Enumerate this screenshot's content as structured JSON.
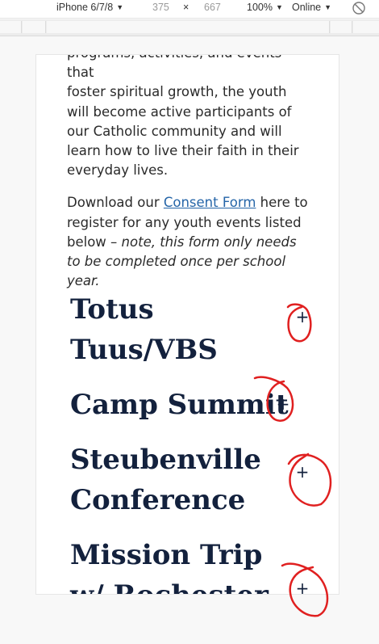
{
  "devtools": {
    "device": "iPhone 6/7/8",
    "width": "375",
    "times": "×",
    "height": "667",
    "zoom": "100%",
    "network": "Online"
  },
  "page": {
    "partial_line": "programs, activities, and events that",
    "paragraph1": "foster spiritual growth, the youth will become active participants of our Catholic community and will learn how to live their faith in their everyday lives.",
    "p2_before": "Download our ",
    "consent_link": "Consent Form",
    "p2_after": " here to register for any youth events listed below – ",
    "p2_note": "note, this form only needs to be completed once per school year."
  },
  "accordion": [
    {
      "title": "Totus Tuus/VBS",
      "toggle": "+"
    },
    {
      "title": "Camp Summit",
      "toggle": "+"
    },
    {
      "title": "Steubenville Conference",
      "toggle": "+"
    },
    {
      "title": "Mission Trip w/ Rochester",
      "toggle": "+"
    }
  ],
  "colors": {
    "heading": "#13213d",
    "link": "#2565a8",
    "annotation": "#e02020"
  }
}
